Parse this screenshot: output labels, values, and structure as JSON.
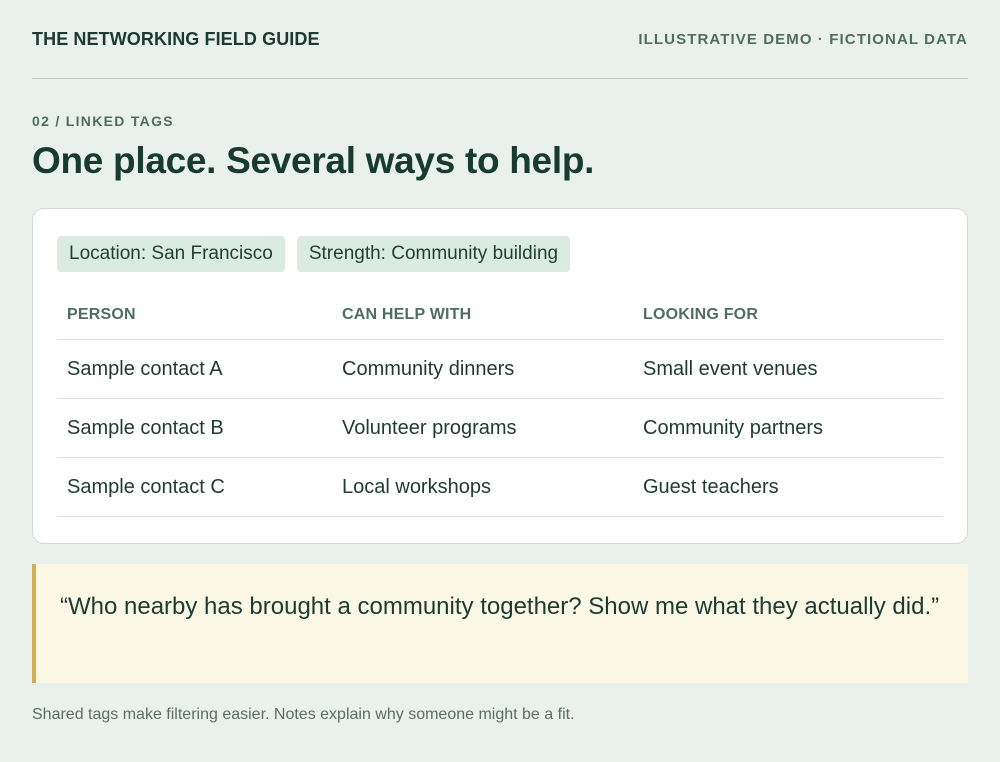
{
  "header": {
    "brand": "THE NETWORKING FIELD GUIDE",
    "disclaimer": "ILLUSTRATIVE DEMO · FICTIONAL DATA"
  },
  "section": {
    "eyebrow": "02 / LINKED TAGS",
    "headline": "One place. Several ways to help."
  },
  "tags": [
    {
      "label": "Location: San Francisco"
    },
    {
      "label": "Strength: Community building"
    }
  ],
  "table": {
    "columns": [
      "PERSON",
      "CAN HELP WITH",
      "LOOKING FOR"
    ],
    "rows": [
      [
        "Sample contact A",
        "Community dinners",
        "Small event venues"
      ],
      [
        "Sample contact B",
        "Volunteer programs",
        "Community partners"
      ],
      [
        "Sample contact C",
        "Local workshops",
        "Guest teachers"
      ]
    ]
  },
  "quote": {
    "text": "“Who nearby has brought a community together? Show me what they actually did.”"
  },
  "footnote": "Shared tags make filtering easier. Notes explain why someone might be a fit.",
  "colors": {
    "background": "#eaf1ec",
    "tag_background": "#dcebe1",
    "quote_background": "#fbf7e5",
    "quote_accent": "#d3ad55",
    "heading_text": "#173a31"
  }
}
